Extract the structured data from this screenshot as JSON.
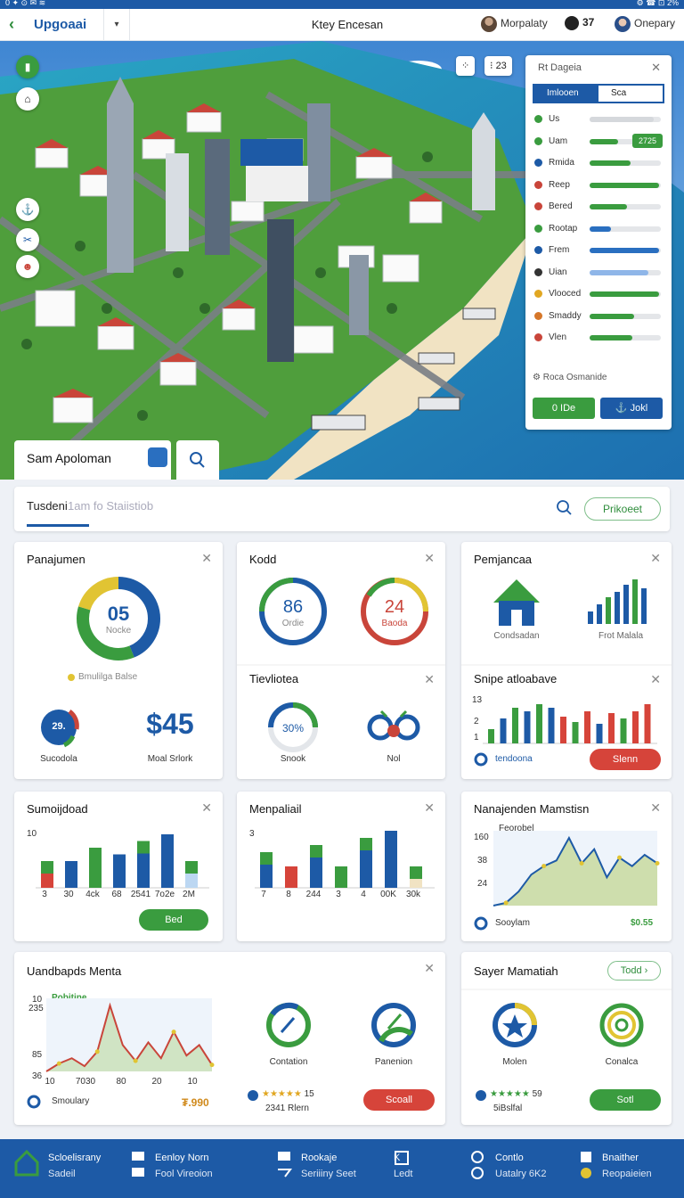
{
  "status_bar": {
    "left": "0 ✦ ⊙ ✉ ≋",
    "right": "⚙ ☎ ⊡ 2%"
  },
  "top_bar": {
    "back_label": "‹",
    "title": "Upgoaai",
    "center_title": "Ktey Encesan",
    "user": "Morpalaty",
    "gold": "37",
    "company": "Onepary"
  },
  "map": {
    "top_buttons": {
      "grid": "⁘",
      "zoom": "23"
    },
    "panel": {
      "title": "Rt Dageia",
      "tabs": [
        "Imlooen",
        "Sca"
      ],
      "rows": [
        {
          "label": "Us",
          "value": 0.9,
          "color": "#d5d8dc"
        },
        {
          "label": "Uam",
          "value": 0.4,
          "color": "#3a9c3f",
          "badge": "2725"
        },
        {
          "label": "Rmida",
          "value": 0.58,
          "color": "#3a9c3f"
        },
        {
          "label": "Reep",
          "value": 0.98,
          "color": "#3a9c3f"
        },
        {
          "label": "Bered",
          "value": 0.52,
          "color": "#3a9c3f"
        },
        {
          "label": "Rootap",
          "value": 0.3,
          "color": "#2a6fc0"
        },
        {
          "label": "Frem",
          "value": 0.98,
          "color": "#2a6fc0"
        },
        {
          "label": "Uian",
          "value": 0.82,
          "color": "#8fb6e8"
        },
        {
          "label": "Vlooced",
          "value": 0.98,
          "color": "#3a9c3f"
        },
        {
          "label": "Smaddy",
          "value": 0.62,
          "color": "#3a9c3f"
        },
        {
          "label": "Vlen",
          "value": 0.6,
          "color": "#3a9c3f"
        }
      ],
      "footer": "Roca Osmanide",
      "btn_left": "0 IDe",
      "btn_right": "Jokl"
    }
  },
  "search_card": {
    "name": "Sam Apoloman"
  },
  "tabs_bar": {
    "active": "Tusdeni",
    "placeholder": "1am  fo Staiistiob",
    "button": "Prikoeet"
  },
  "cards": {
    "panajumen": {
      "title": "Panajumen",
      "donut_value": "05",
      "donut_sub": "Nocke",
      "legend": "Bmulilga Balse",
      "badge_value": "29.",
      "badge_label": "Sucodola",
      "price": "$45",
      "price_label": "Moal Srlork"
    },
    "kodd": {
      "title": "Kodd",
      "g1_value": "86",
      "g1_sub": "Ordie",
      "g2_value": "24",
      "g2_sub": "Baoda",
      "sub_title": "Tievliotea",
      "g3_value": "30%",
      "g3_label": "Snook",
      "g4_label": "Nol"
    },
    "pemjancaa": {
      "title": "Pemjancaa",
      "house_label": "Condsadan",
      "bars_label": "Frot Malala",
      "sub_title": "Snipe atloabave",
      "left_label": "tendoona",
      "button": "Slenn",
      "yticks": [
        "13",
        "2",
        "1"
      ]
    },
    "sumoijdoad": {
      "title": "Sumoijdoad",
      "ytop": "10",
      "xticks": [
        "3",
        "30",
        "4ck",
        "68",
        "2541",
        "7o2e",
        "2M"
      ],
      "button": "Bed"
    },
    "menpaliail": {
      "title": "Menpaliail",
      "ytop": "3",
      "xticks": [
        "7",
        "8",
        "244",
        "3",
        "4",
        "00K",
        "30k"
      ]
    },
    "nanajenden": {
      "title": "Nanajenden Mamstisn",
      "subtitle": "Feorobel",
      "yticks": [
        "160",
        "38",
        "24"
      ],
      "left_label": "Sooylam",
      "right_value": "$0.55"
    },
    "uandbapds": {
      "title": "Uandbapds Menta",
      "subtitle": "Pobitine",
      "yticks": [
        "10",
        "235",
        "85",
        "36"
      ],
      "xticks": [
        "10",
        "7030",
        "80",
        "20",
        "10"
      ],
      "left_label": "Smoulary",
      "right_value": "₮.990",
      "icon1_label": "Contation",
      "icon2_label": "Panenion",
      "rating": "15",
      "rating_sub": "2341 Rlern",
      "button": "Scoall"
    },
    "sayer": {
      "title": "Sayer Mamatiah",
      "top_button": "Todd",
      "icon1_label": "Molen",
      "icon2_label": "Conalca",
      "rating": "59",
      "rating_sub": "5iBslfal",
      "button": "Sotl"
    }
  },
  "chart_data": [
    {
      "type": "bar",
      "title": "Sumoijdoad",
      "categories": [
        "3",
        "30",
        "4ck",
        "68",
        "2541",
        "7o2e",
        "2M"
      ],
      "series": [
        {
          "values": [
            4,
            4,
            6,
            5,
            7,
            8,
            4
          ]
        }
      ]
    },
    {
      "type": "bar",
      "title": "Menpaliail",
      "categories": [
        "7",
        "8",
        "244",
        "3",
        "4",
        "00K",
        "30k"
      ],
      "series": [
        {
          "values": [
            5,
            3,
            6,
            3,
            7,
            8,
            3
          ]
        }
      ]
    },
    {
      "type": "area",
      "title": "Nanajenden Mamstisn",
      "series": [
        {
          "values": [
            30,
            32,
            40,
            52,
            58,
            62,
            78,
            60,
            70,
            50,
            64,
            58,
            66,
            60
          ]
        }
      ]
    },
    {
      "type": "area",
      "title": "Uandbapds Menta",
      "series": [
        {
          "values": [
            40,
            46,
            50,
            44,
            55,
            90,
            60,
            48,
            62,
            50,
            70,
            52,
            60,
            45
          ]
        }
      ]
    }
  ],
  "bottom_nav": [
    {
      "label": "Scloelisrany",
      "sub": "Sadeil"
    },
    {
      "label": "Eenloy Norn",
      "sub": "Fool Vireoion"
    },
    {
      "label": "Rookaje",
      "sub": "Seriiiny Seet"
    },
    {
      "label": "K",
      "sub": "Ledt"
    },
    {
      "label": "Contlo",
      "sub": "Uatalry 6K2"
    },
    {
      "label": "Bnaither",
      "sub": "Reopaieien"
    }
  ]
}
